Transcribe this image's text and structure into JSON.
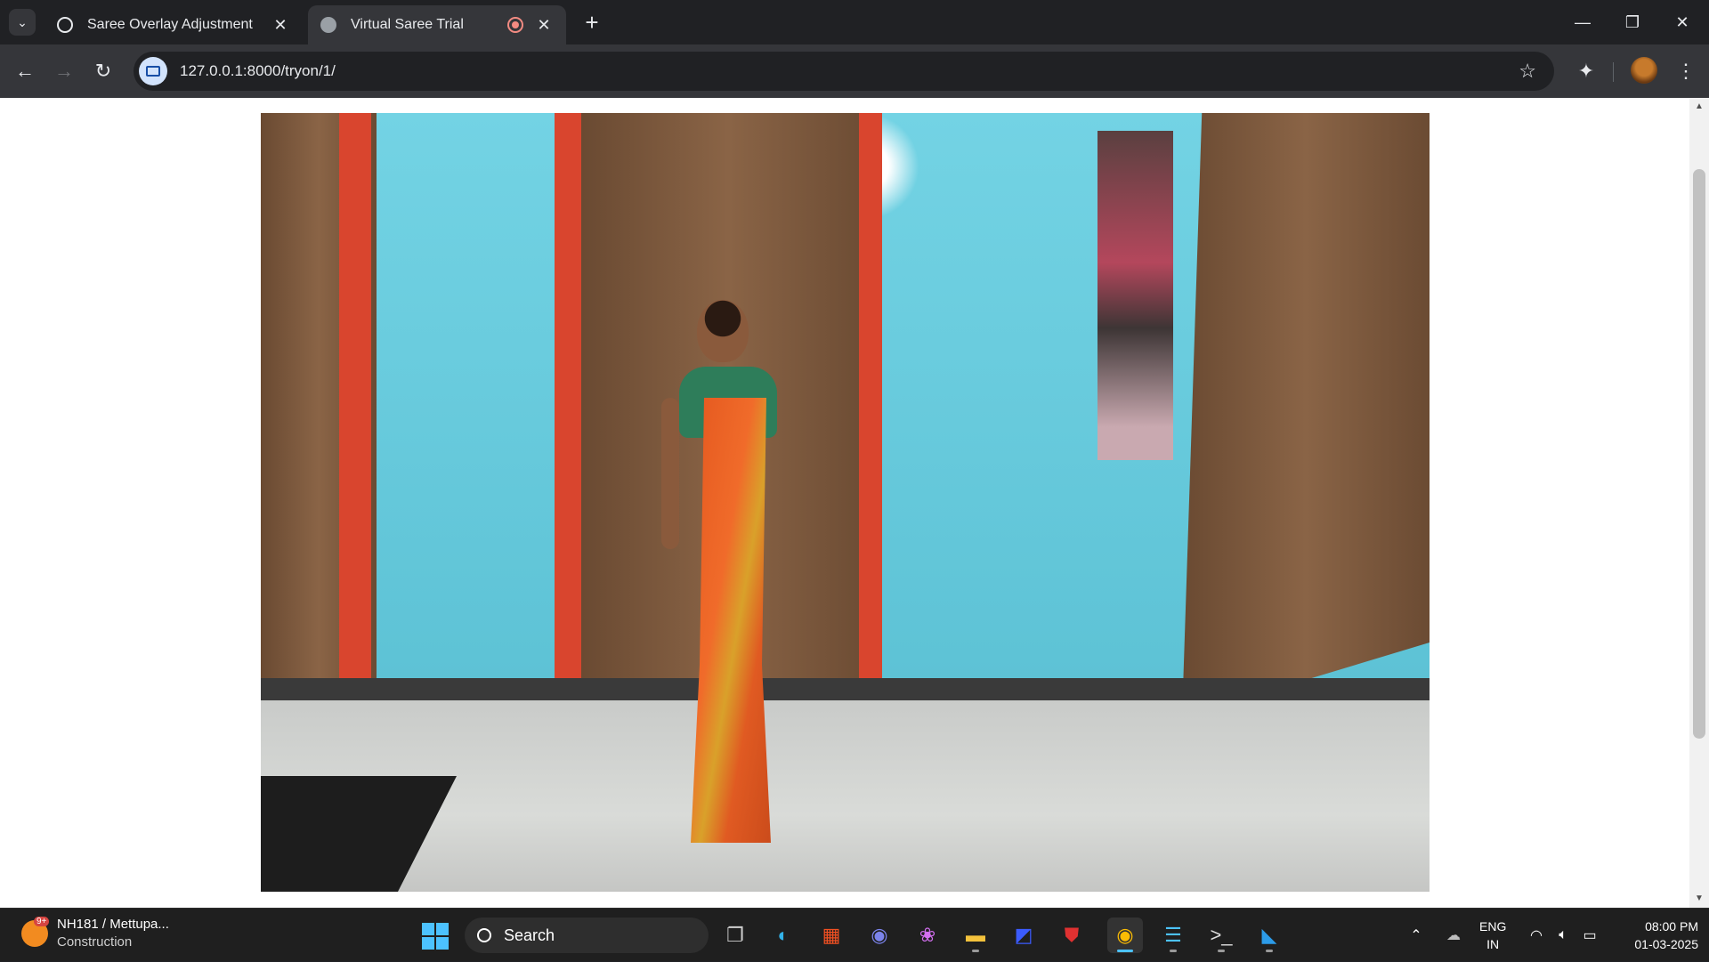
{
  "browser": {
    "tabs": [
      {
        "title": "Saree Overlay Adjustment",
        "active": false
      },
      {
        "title": "Virtual Saree Trial",
        "active": true
      }
    ],
    "url": "127.0.0.1:8000/tryon/1/",
    "accent": "#4cc2ff"
  },
  "icons": {
    "tab_search": "chevron-down",
    "close": "close",
    "new_tab": "plus",
    "minimize": "minimize",
    "restore": "restore",
    "window_close": "close",
    "back": "arrow-left",
    "forward": "arrow-right",
    "reload": "reload",
    "bookmark": "star",
    "extensions": "puzzle",
    "menu": "more-vertical"
  },
  "page": {
    "video_description_alt": "camera feed"
  },
  "taskbar": {
    "weather_title": "NH181 / Mettupa...",
    "weather_sub": "Construction",
    "weather_badge": "9+",
    "search_label": "Search",
    "lang_line1": "ENG",
    "lang_line2": "IN",
    "time": "08:00 PM",
    "date": "01-03-2025"
  }
}
